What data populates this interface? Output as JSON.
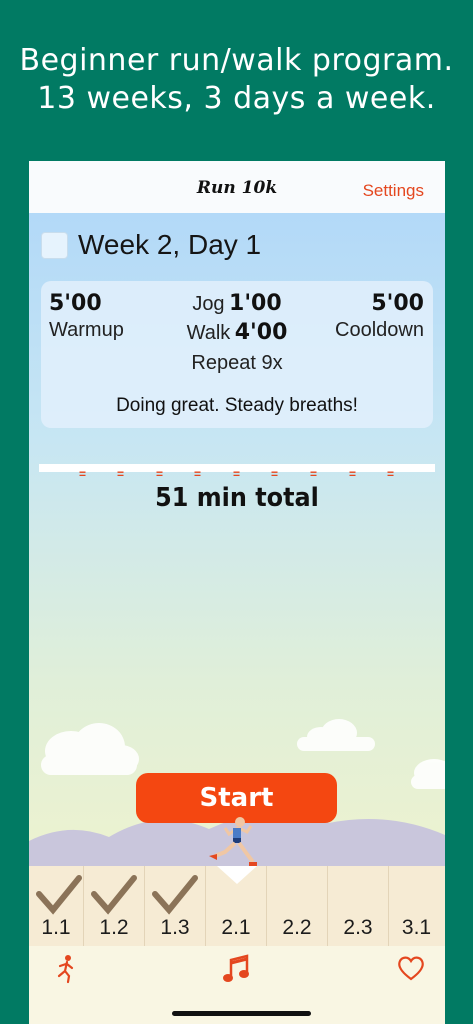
{
  "promo": {
    "line1": "Beginner run/walk program.",
    "line2": "13 weeks, 3 days a week."
  },
  "navbar": {
    "title": "Run 10k",
    "settings_label": "Settings"
  },
  "workout": {
    "day_title": "Week 2, Day 1",
    "warmup_time": "5'00",
    "warmup_label": "Warmup",
    "jog_label": "Jog",
    "jog_time": "1'00",
    "walk_label": "Walk",
    "walk_time": "4'00",
    "repeat_label": "Repeat 9x",
    "cooldown_time": "5'00",
    "cooldown_label": "Cooldown",
    "encouragement": "Doing great. Steady breaths!",
    "total": "51 min total"
  },
  "start_label": "Start",
  "days": [
    {
      "label": "1.1",
      "done": true
    },
    {
      "label": "1.2",
      "done": true
    },
    {
      "label": "1.3",
      "done": true
    },
    {
      "label": "2.1",
      "done": false,
      "selected": true
    },
    {
      "label": "2.2",
      "done": false
    },
    {
      "label": "2.3",
      "done": false
    },
    {
      "label": "3.1",
      "done": false
    }
  ],
  "tabs": [
    "runner-icon",
    "music-note-icon",
    "heart-icon"
  ],
  "colors": {
    "background": "#017a63",
    "accent": "#e4471f",
    "start": "#f44711"
  }
}
